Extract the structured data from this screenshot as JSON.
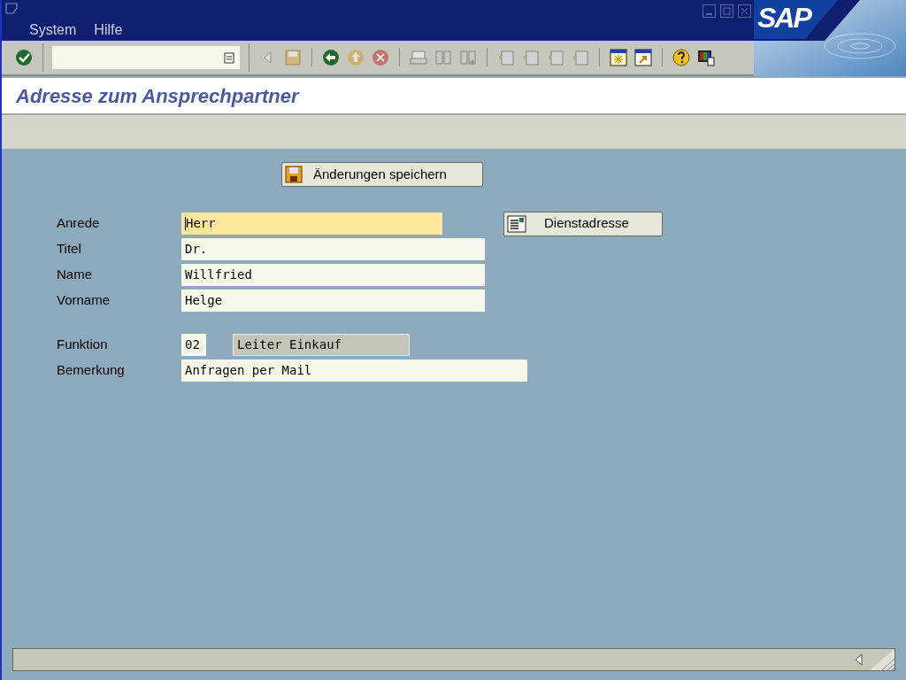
{
  "menu": [
    "System",
    "Hilfe"
  ],
  "logo": "SAP",
  "screen_title": "Adresse zum Ansprechpartner",
  "save_button": "Änderungen speichern",
  "side_button": "Dienstadresse",
  "sections": [
    [
      {
        "label": "Anrede",
        "fields": [
          {
            "value": "Herr",
            "kind": "input",
            "focused": true
          }
        ]
      },
      {
        "label": "Titel",
        "fields": [
          {
            "value": "Dr.",
            "kind": "input",
            "focused": false
          }
        ]
      },
      {
        "label": "Name",
        "fields": [
          {
            "value": "Willfried",
            "kind": "input",
            "focused": false
          }
        ]
      },
      {
        "label": "Vorname",
        "fields": [
          {
            "value": "Helge",
            "kind": "input",
            "focused": false
          }
        ]
      }
    ],
    [
      {
        "label": "Funktion",
        "fields": [
          {
            "value": "02",
            "kind": "input",
            "focused": false
          },
          {
            "value": "Leiter Einkauf",
            "kind": "display",
            "focused": false
          }
        ]
      },
      {
        "label": "Bemerkung",
        "fields": [
          {
            "value": "Anfragen per Mail",
            "kind": "input",
            "focused": false
          }
        ]
      }
    ]
  ]
}
